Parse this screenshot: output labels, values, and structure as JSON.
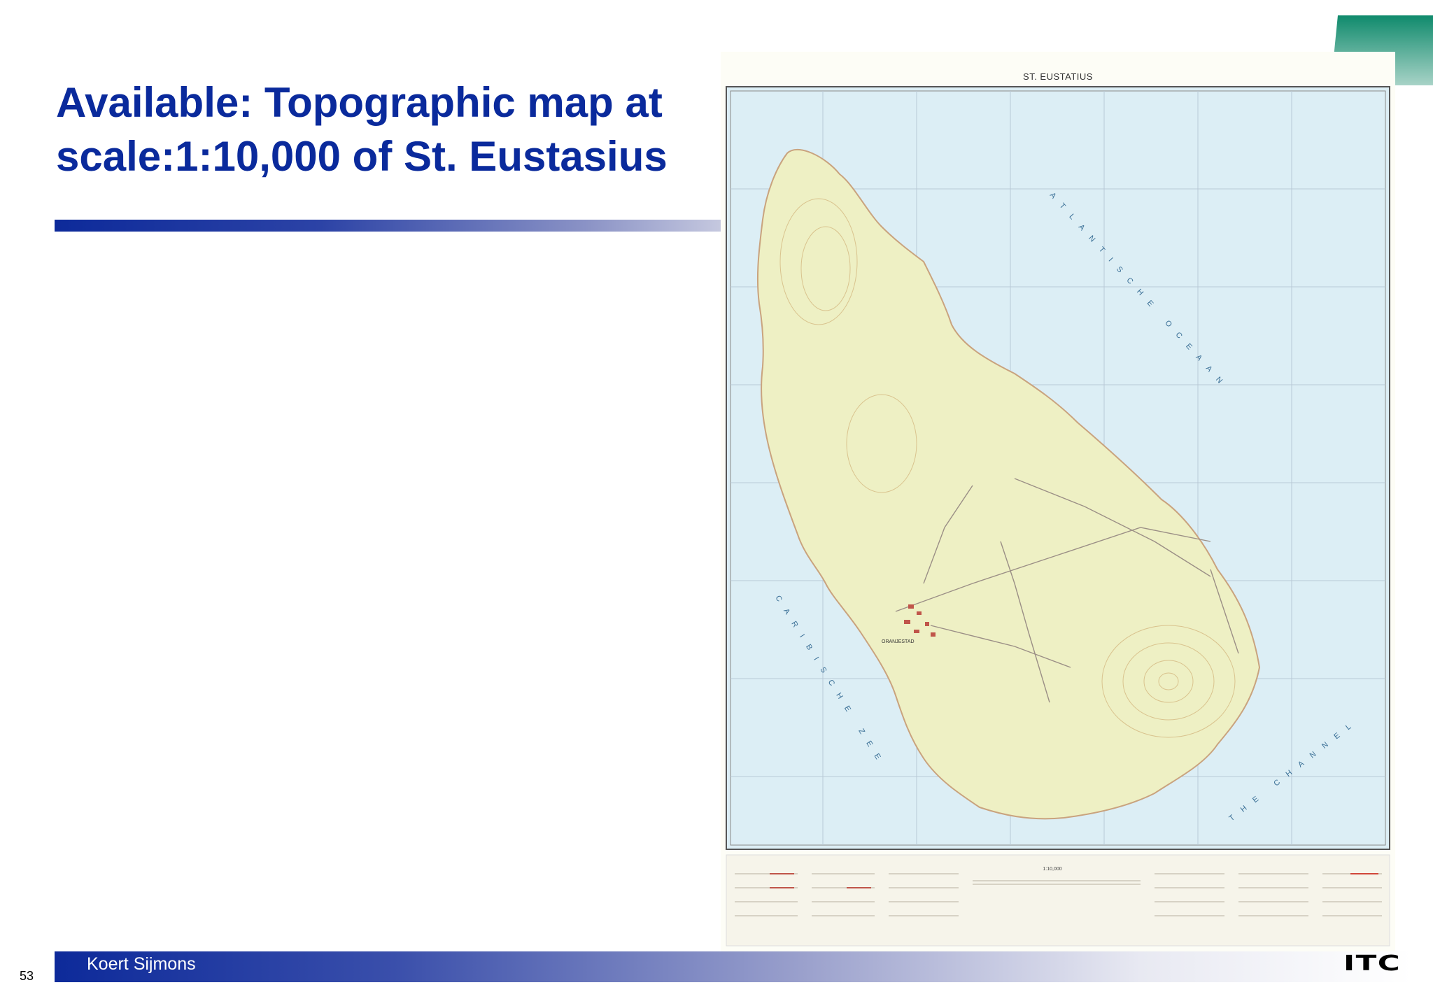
{
  "slide": {
    "title_line1": "Available: Topographic map at",
    "title_line2": "scale:1:10,000 of St. Eustasius",
    "author": "Koert Sijmons",
    "page_number": "53",
    "logo": "ITC"
  },
  "map": {
    "header": "ST. EUSTATIUS",
    "sea_labels": {
      "atlantic": "ATLANTISCHE OCEAAN",
      "caribbean": "CARIBISCHE ZEE",
      "channel": "THE CHANNEL"
    },
    "town": "ORANJESTAD",
    "scale_label": "1:10,000"
  },
  "colors": {
    "title": "#0a2a9c",
    "accent_green": "#0f8a6c",
    "sea": "#dceef5",
    "land": "#eef0c4"
  }
}
